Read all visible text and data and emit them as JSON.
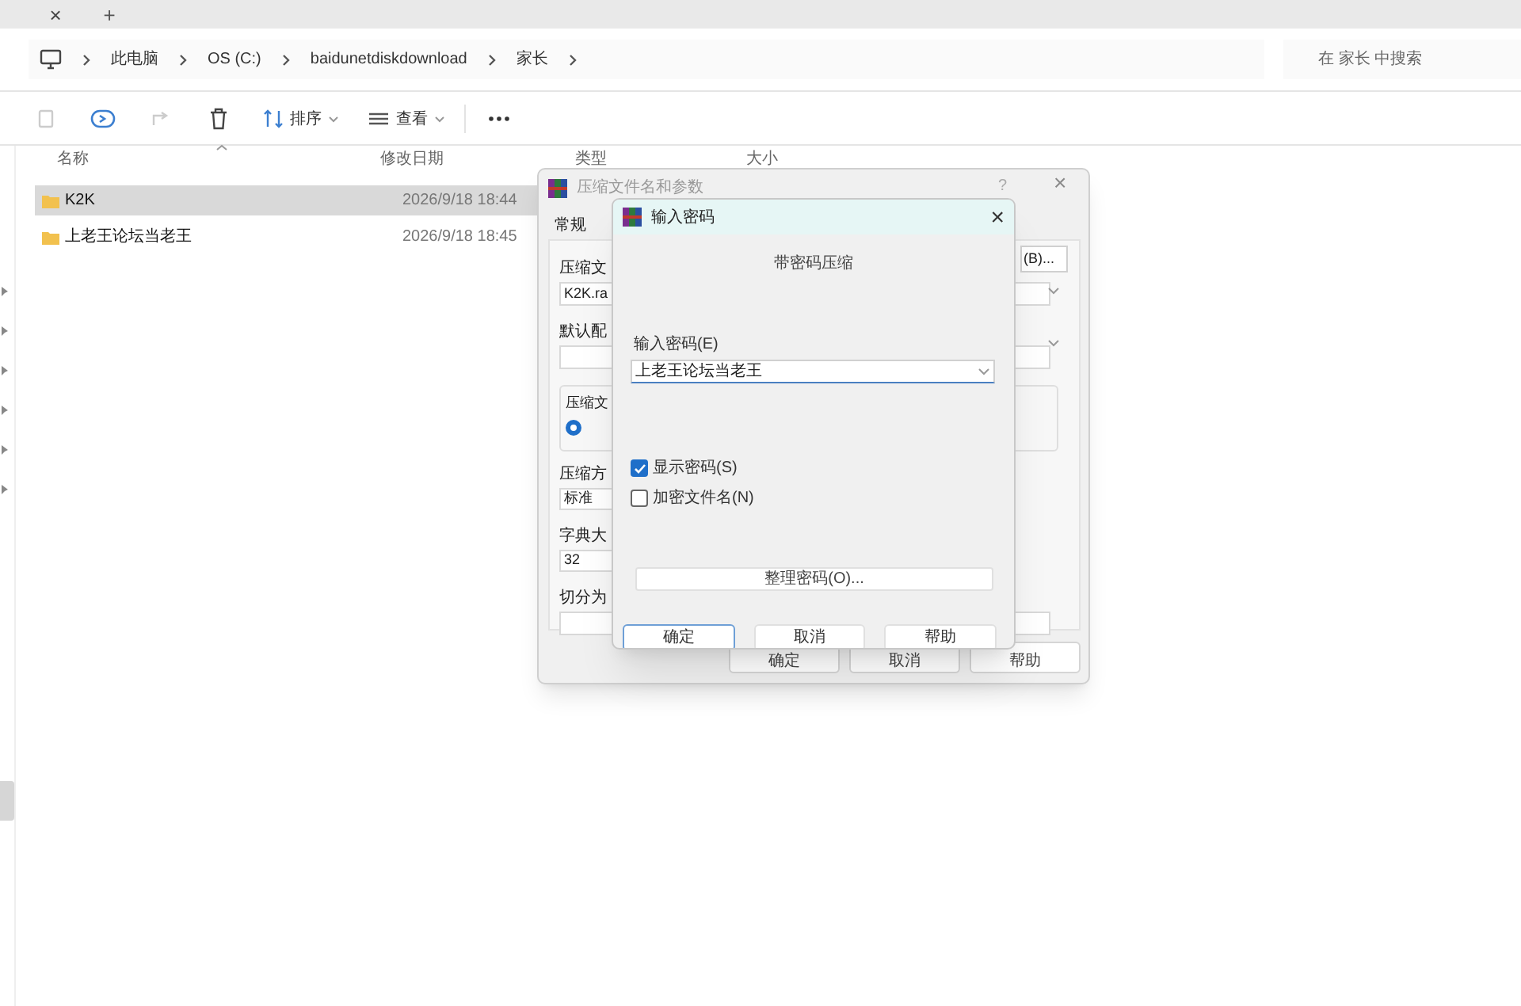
{
  "browser_tabs": {
    "close": "×",
    "new_tab": "+"
  },
  "address_bar": {
    "segments": [
      "此电脑",
      "OS (C:)",
      "baidunetdiskdownload",
      "家长"
    ]
  },
  "search": {
    "placeholder": "在 家长 中搜索"
  },
  "toolbar": {
    "sort": "排序",
    "view": "查看"
  },
  "file_list": {
    "columns": [
      "名称",
      "修改日期",
      "类型",
      "大小"
    ],
    "rows": [
      {
        "name": "K2K",
        "modified": "2026/9/18 18:44",
        "selected": true
      },
      {
        "name": "上老王论坛当老王",
        "modified": "2026/9/18 18:45",
        "selected": false
      }
    ]
  },
  "archive_dialog": {
    "title": "压缩文件名和参数",
    "help": "?",
    "close": "×",
    "tabs": [
      {
        "label": "常规",
        "selected": true
      }
    ],
    "left_items": [
      {
        "kind": "label",
        "text": "压缩文"
      },
      {
        "kind": "field",
        "text": "K2K.ra"
      },
      {
        "kind": "label",
        "text": "默认配"
      },
      {
        "kind": "field"
      },
      {
        "kind": "group",
        "text": "压缩文",
        "radio_selected": true
      },
      {
        "kind": "label",
        "text": "压缩方"
      },
      {
        "kind": "combo",
        "text": "标准"
      },
      {
        "kind": "label",
        "text": "字典大"
      },
      {
        "kind": "combo",
        "text": "32"
      },
      {
        "kind": "label",
        "text": "切分为"
      },
      {
        "kind": "field"
      }
    ],
    "browse_button": "(B)...",
    "buttons": [
      "确定",
      "取消",
      "帮助"
    ]
  },
  "password_dialog": {
    "title": "输入密码",
    "close": "×",
    "heading": "带密码压缩",
    "field_label": "输入密码(E)",
    "password": "上老王论坛当老王",
    "options": [
      {
        "label": "显示密码(S)",
        "checked": true
      },
      {
        "label": "加密文件名(N)",
        "checked": false
      }
    ],
    "organize_button": "整理密码(O)...",
    "buttons": [
      {
        "label": "确定",
        "default": true
      },
      {
        "label": "取消",
        "default": false
      },
      {
        "label": "帮助",
        "default": false
      }
    ]
  }
}
